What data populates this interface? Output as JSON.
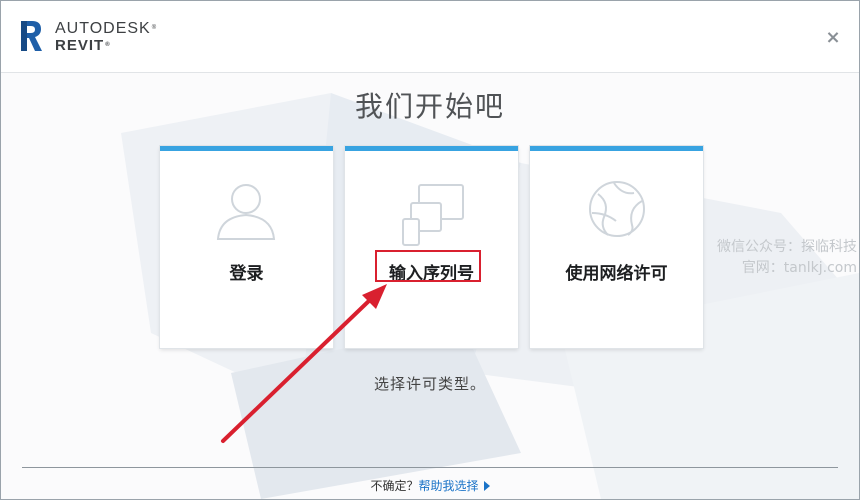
{
  "window": {
    "brand_line1": "AUTODESK",
    "brand_line2": "REVIT",
    "close_glyph": "×"
  },
  "heading": "我们开始吧",
  "cards": [
    {
      "label": "登录",
      "icon": "user-icon"
    },
    {
      "label": "输入序列号",
      "icon": "devices-icon"
    },
    {
      "label": "使用网络许可",
      "icon": "network-globe-icon"
    }
  ],
  "subtitle": "选择许可类型。",
  "footer": {
    "prefix": "不确定？",
    "help_link": "帮助我选择"
  },
  "watermark": {
    "line1": "微信公众号：探临科技",
    "line2": "官网：tanlkj.com"
  },
  "colors": {
    "accent": "#38a3e1",
    "highlight": "#d9202f",
    "link": "#1a73c7"
  }
}
